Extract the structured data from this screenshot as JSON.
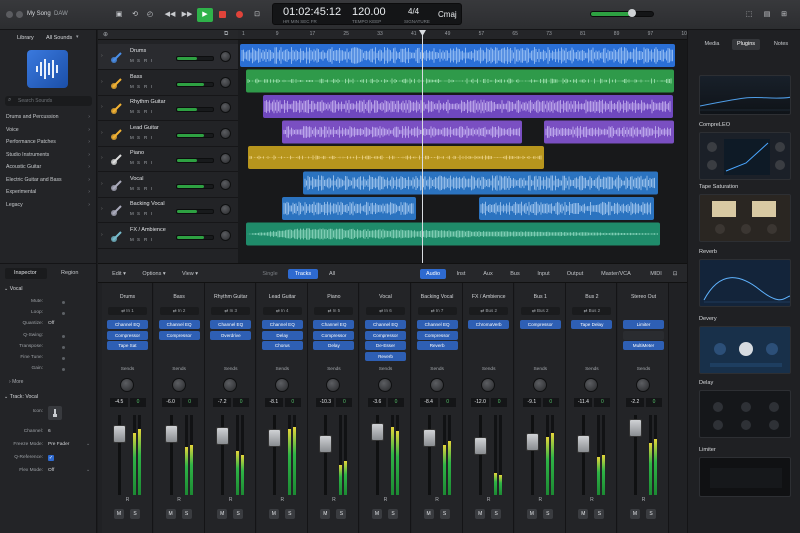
{
  "title": {
    "project": "My Song",
    "app": "DAW"
  },
  "lcd": {
    "time": "01:02:45:12",
    "tempo": "120.00",
    "signature": "4/4",
    "key": "Cmaj",
    "labels": {
      "time": "HR MIN SEC FR",
      "tempo": "TEMPO KEEP",
      "sig": "SIGNATURE"
    }
  },
  "library": {
    "tab_library": "Library",
    "tab_all": "All Sounds",
    "search_placeholder": "Search Sounds",
    "items": [
      "Drums and Percussion",
      "Voice",
      "Performance Patches",
      "Studio Instruments",
      "Acoustic Guitar",
      "Electric Guitar and Bass",
      "Experimental",
      "Legacy"
    ]
  },
  "inspector": {
    "tab_inspector": "Inspector",
    "tab_region": "Region",
    "region_section": "Vocal",
    "region_rows": [
      {
        "k": "Mute:",
        "v": ""
      },
      {
        "k": "Loop:",
        "v": ""
      },
      {
        "k": "Quantize:",
        "v": "Off"
      },
      {
        "k": "Q-Swing:",
        "v": ""
      },
      {
        "k": "Transpose:",
        "v": ""
      },
      {
        "k": "Fine Tune:",
        "v": ""
      },
      {
        "k": "Gain:",
        "v": ""
      }
    ],
    "more": "More",
    "track_section": "Track: Vocal",
    "track_rows": [
      {
        "k": "Icon:",
        "v": ""
      },
      {
        "k": "Channel:",
        "v": "6"
      },
      {
        "k": "Freeze Mode:",
        "v": "Pre Fader"
      },
      {
        "k": "Q-Reference:",
        "v": ""
      },
      {
        "k": "Flex Mode:",
        "v": "Off"
      }
    ]
  },
  "tracks": [
    {
      "name": "Drums",
      "color": "#2a6fd6"
    },
    {
      "name": "Bass",
      "color": "#2f9a4a"
    },
    {
      "name": "Rhythm Guitar",
      "color": "#7a4fc2"
    },
    {
      "name": "Lead Guitar",
      "color": "#7a4fc2"
    },
    {
      "name": "Piano",
      "color": "#b7951d"
    },
    {
      "name": "Vocal",
      "color": "#2a78c6"
    },
    {
      "name": "Backing Vocal",
      "color": "#2a78c6"
    },
    {
      "name": "FX / Ambience",
      "color": "#1f8b6a"
    }
  ],
  "track_ms": {
    "m": "M",
    "s": "S",
    "r": "R",
    "i": "I"
  },
  "ruler": [
    "1",
    "9",
    "17",
    "25",
    "33",
    "41",
    "49",
    "57",
    "65",
    "73",
    "81",
    "89",
    "97",
    "105"
  ],
  "mixer_bar": {
    "edit": "Edit",
    "options": "Options",
    "view": "View",
    "single": "Single",
    "tracks": "Tracks",
    "all": "All",
    "filters": [
      "Audio",
      "Inst",
      "Aux",
      "Bus",
      "Input",
      "Output",
      "Master/VCA",
      "MIDI"
    ]
  },
  "mixer": [
    {
      "name": "Drums",
      "input": "In 1",
      "plugins": [
        "Channel EQ",
        "Compressor",
        "Tape Sat"
      ],
      "db": "-4.5",
      "pan": "0"
    },
    {
      "name": "Bass",
      "input": "In 2",
      "plugins": [
        "Channel EQ",
        "Compressor"
      ],
      "db": "-6.0",
      "pan": "0"
    },
    {
      "name": "Rhythm Guitar",
      "input": "In 3",
      "plugins": [
        "Channel EQ",
        "Overdrive"
      ],
      "db": "-7.2",
      "pan": "0"
    },
    {
      "name": "Lead Guitar",
      "input": "In 4",
      "plugins": [
        "Channel EQ",
        "Delay",
        "Chorus"
      ],
      "db": "-8.1",
      "pan": "0"
    },
    {
      "name": "Piano",
      "input": "In 5",
      "plugins": [
        "Channel EQ",
        "Compressor",
        "Delay"
      ],
      "db": "-10.3",
      "pan": "0"
    },
    {
      "name": "Vocal",
      "input": "In 6",
      "plugins": [
        "Channel EQ",
        "Compressor",
        "De-Esser",
        "Reverb"
      ],
      "db": "-3.6",
      "pan": "0"
    },
    {
      "name": "Backing Vocal",
      "input": "In 7",
      "plugins": [
        "Channel EQ",
        "Compressor",
        "Reverb"
      ],
      "db": "-8.4",
      "pan": "0"
    },
    {
      "name": "FX / Ambience",
      "input": "Bus 2",
      "plugins": [
        "ChromaVerb"
      ],
      "db": "-12.0",
      "pan": "0"
    },
    {
      "name": "Bus 1",
      "input": "Bus 2",
      "plugins": [
        "Compressor"
      ],
      "db": "-9.1",
      "pan": "0"
    },
    {
      "name": "Bus 2",
      "input": "Bus 2",
      "plugins": [
        "Tape Delay"
      ],
      "db": "-11.4",
      "pan": "0"
    },
    {
      "name": "Stereo Out",
      "input": "",
      "plugins": [
        "Limiter",
        "",
        "MultiMeter"
      ],
      "db": "-2.2",
      "pan": "0"
    }
  ],
  "mixer_labels": {
    "sends": "Sends",
    "r": "R",
    "m": "M",
    "s": "S"
  },
  "right_panel": {
    "tabs": [
      "Media",
      "Plugins",
      "Notes"
    ],
    "plugins": [
      "CompreLEO",
      "Tape Saturation",
      "Reverb",
      "Devery",
      "Delay",
      "Limiter"
    ]
  },
  "colors": {
    "accent": "#2e6ad0",
    "play": "#2fb24a",
    "record": "#e0433a"
  }
}
